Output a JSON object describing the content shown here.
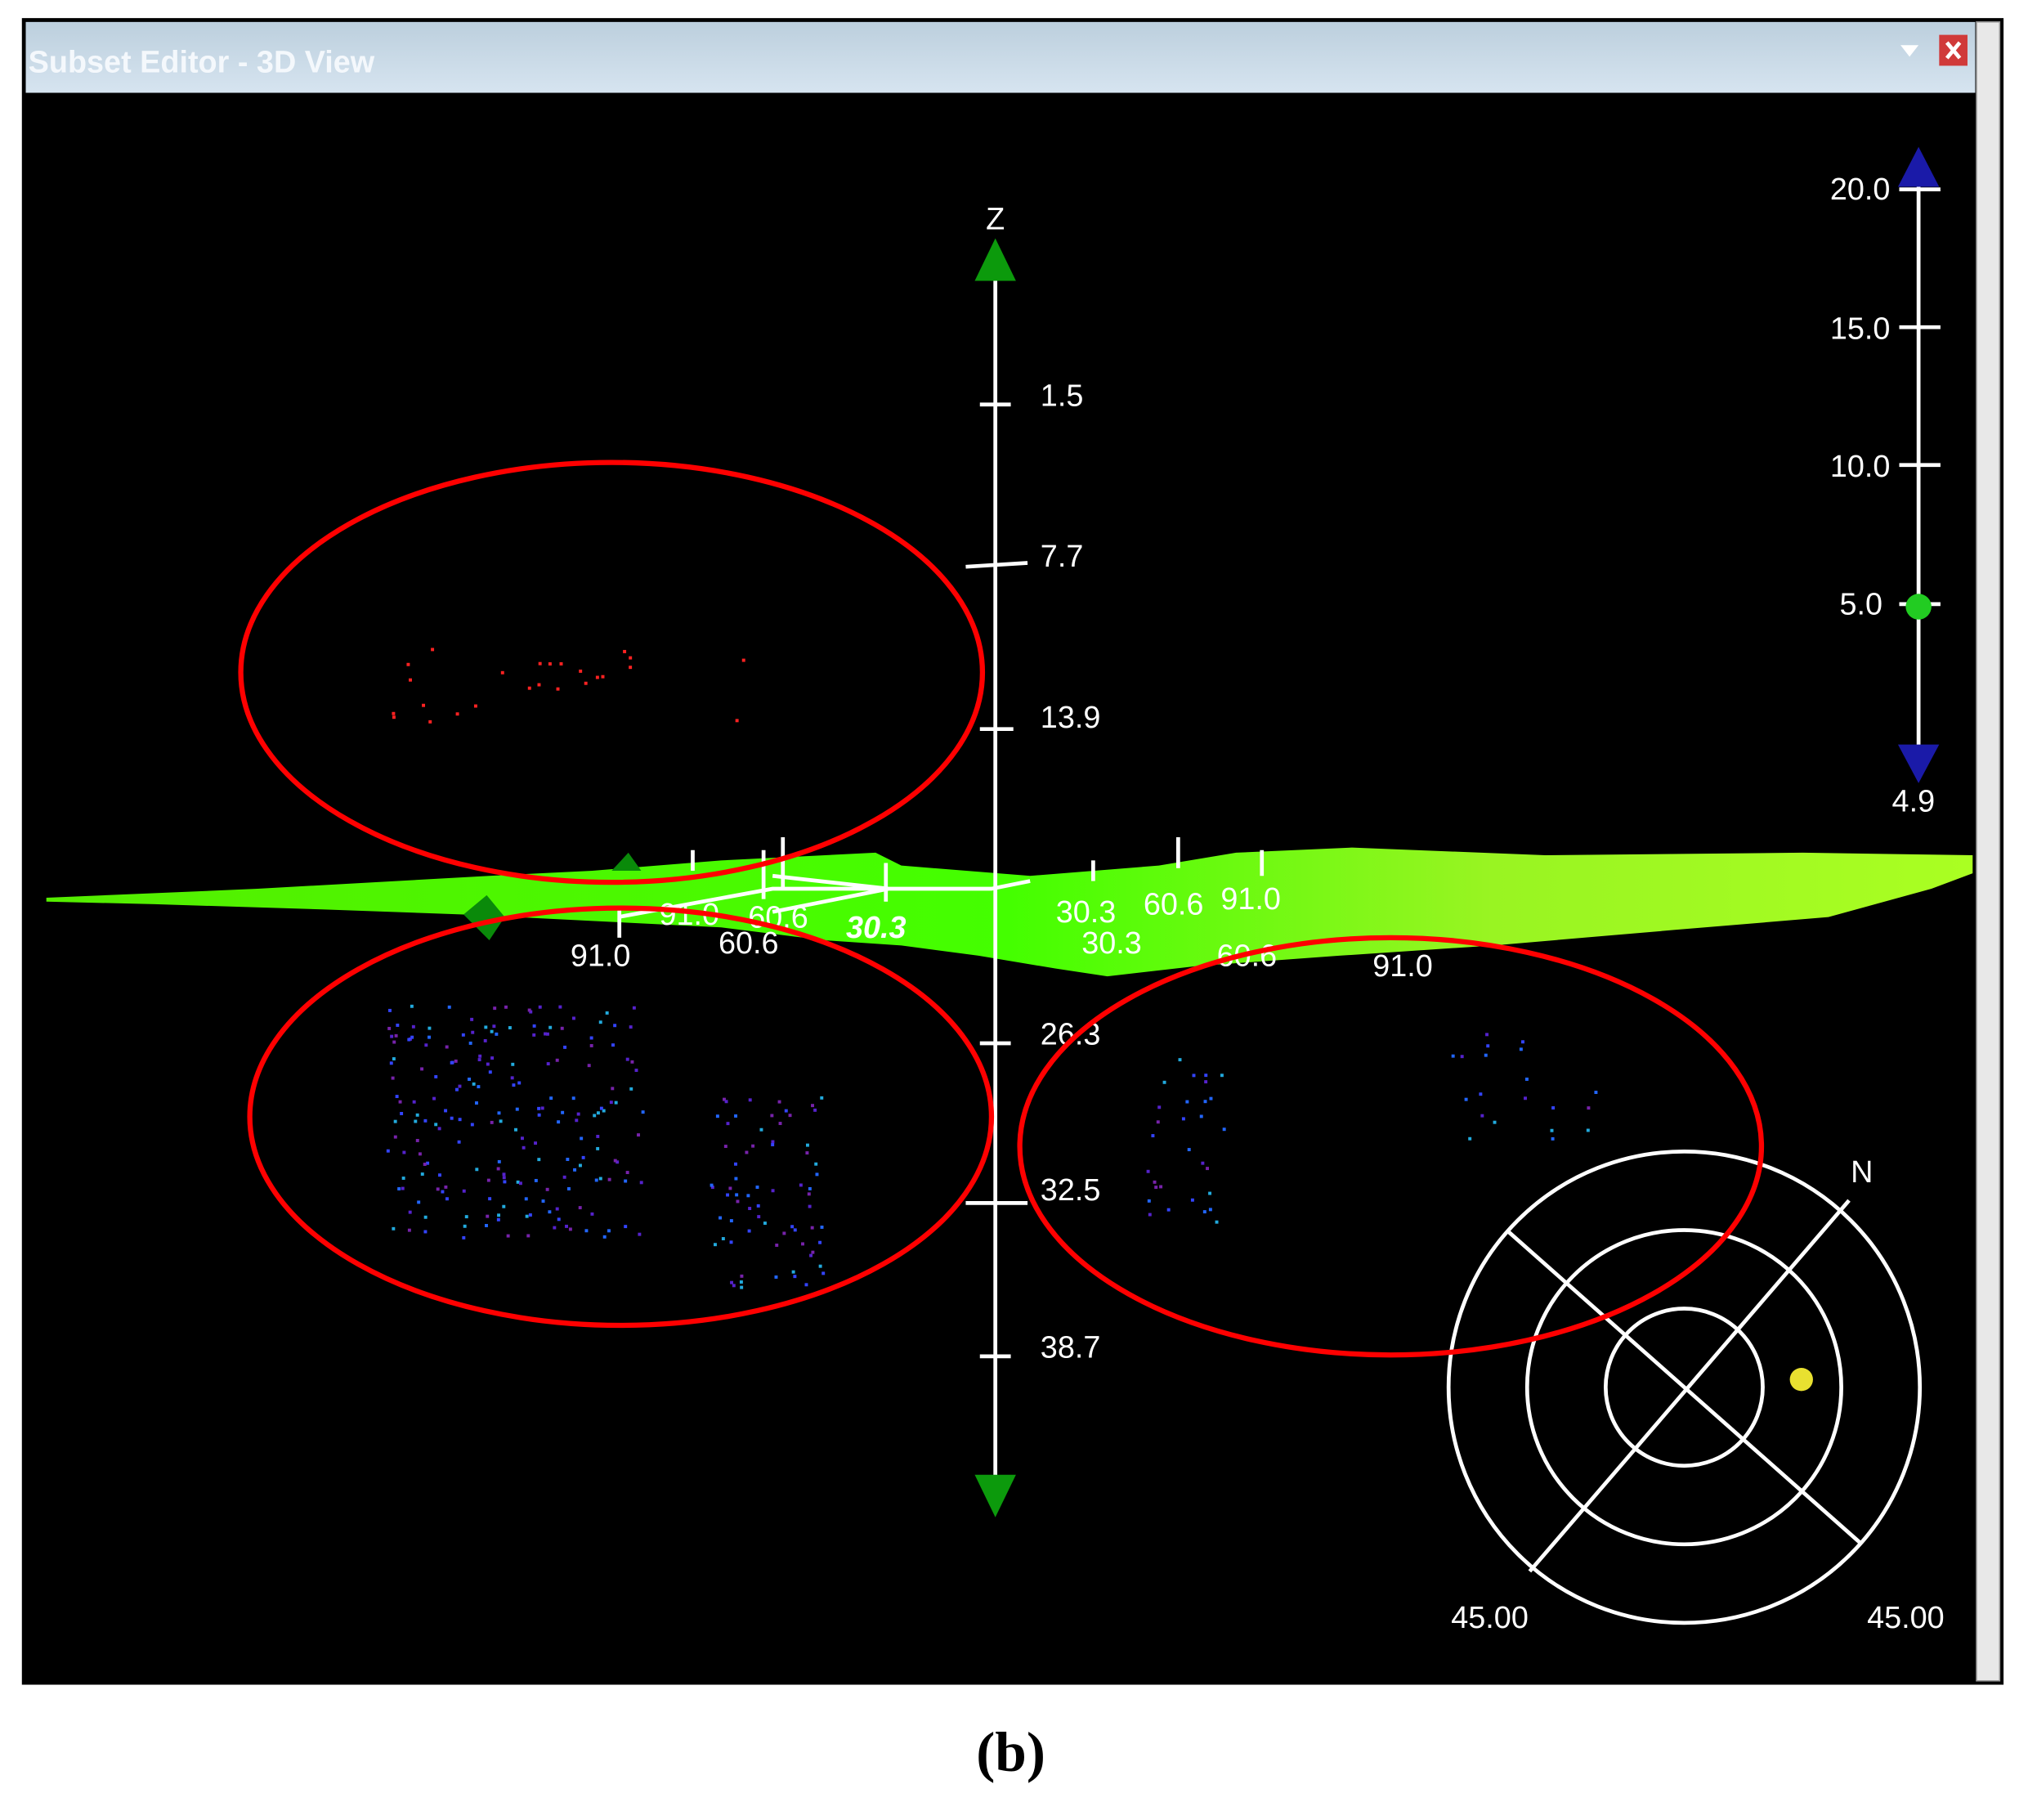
{
  "window": {
    "title": "Subset Editor - 3D View",
    "menu_icon": "dropdown-triangle-icon",
    "close_icon": "close-icon",
    "close_color": "#d03a3a"
  },
  "z_axis": {
    "label": "Z",
    "ticks": [
      "1.5",
      "7.7",
      "13.9",
      "26.3",
      "32.5",
      "38.7"
    ]
  },
  "surface_labels": {
    "left_axis": [
      "91.0",
      "60.6",
      "30.3",
      "91.0",
      "60.6"
    ],
    "right_axis": [
      "30.3",
      "60.6",
      "91.0",
      "30.3",
      "60.6",
      "91.0"
    ]
  },
  "scale_bar": {
    "ticks": [
      "20.0",
      "15.0",
      "10.0",
      "5.0"
    ],
    "min_label": "4.9",
    "slider_value": 5.0
  },
  "compass": {
    "north_label": "N",
    "left_label": "45.00",
    "right_label": "45.00"
  },
  "caption": "(b)",
  "colors": {
    "background": "#000000",
    "surface": "#66ff11",
    "highlight": "#ff0000",
    "titlebar": "#c8d8e6"
  }
}
